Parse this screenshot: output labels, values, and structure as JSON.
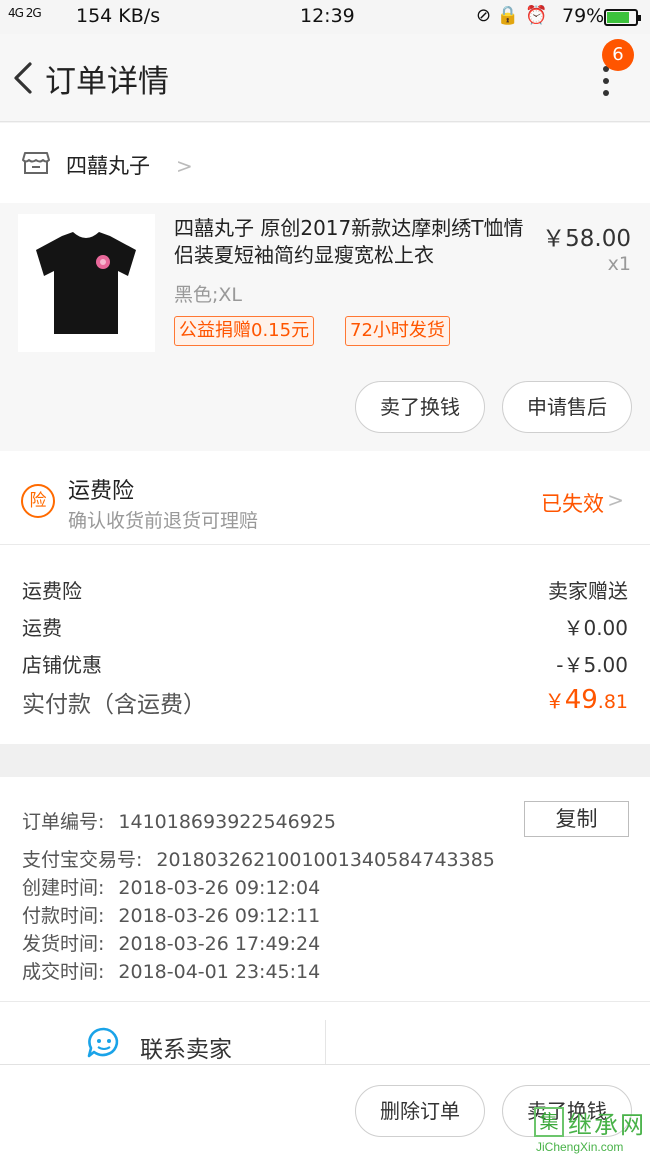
{
  "status_bar": {
    "signal": "4G 2G",
    "speed": "154 KB/s",
    "time": "12:39",
    "icons": "⊘ 🔒 ⏰",
    "battery": "79%",
    "battery_level": 0.79
  },
  "nav": {
    "title": "订单详情",
    "badge": "6"
  },
  "shop": {
    "name": "四囍丸子"
  },
  "product": {
    "title": "四囍丸子 原创2017新款达摩刺绣T恤情侣装夏短袖简约显瘦宽松上衣",
    "price": "￥58.00",
    "qty": "x1",
    "spec": "黑色;XL",
    "tags": [
      "公益捐赠0.15元",
      "72小时发货"
    ],
    "buttons": {
      "sell": "卖了换钱",
      "after_sale": "申请售后"
    }
  },
  "insurance": {
    "icon": "险",
    "title": "运费险",
    "subtitle": "确认收货前退货可理赔",
    "status": "已失效"
  },
  "fees": {
    "rows": [
      {
        "label": "运费险",
        "value": "卖家赠送"
      },
      {
        "label": "运费",
        "value": "￥0.00"
      },
      {
        "label": "店铺优惠",
        "value": "-￥5.00"
      }
    ],
    "total_label": "实付款（含运费）",
    "total_currency": "￥",
    "total_int": "49",
    "total_dec": ".81"
  },
  "order_info": {
    "copy_label": "复制",
    "rows": [
      {
        "key": "订单编号:",
        "value": "141018693922546925"
      },
      {
        "key": "支付宝交易号:",
        "value": "2018032621001001340584743385"
      },
      {
        "key": "创建时间:",
        "value": "2018-03-26 09:12:04"
      },
      {
        "key": "付款时间:",
        "value": "2018-03-26 09:12:11"
      },
      {
        "key": "发货时间:",
        "value": "2018-03-26 17:49:24"
      },
      {
        "key": "成交时间:",
        "value": "2018-04-01 23:45:14"
      }
    ]
  },
  "contact": {
    "label": "联系卖家"
  },
  "bottom": {
    "delete": "删除订单",
    "sell": "卖了换钱"
  },
  "watermark": {
    "text": "继承网",
    "mark": "集",
    "url": "JiChengXin.com"
  },
  "colors": {
    "accent": "#ff5500",
    "battery": "#3cc23c"
  }
}
